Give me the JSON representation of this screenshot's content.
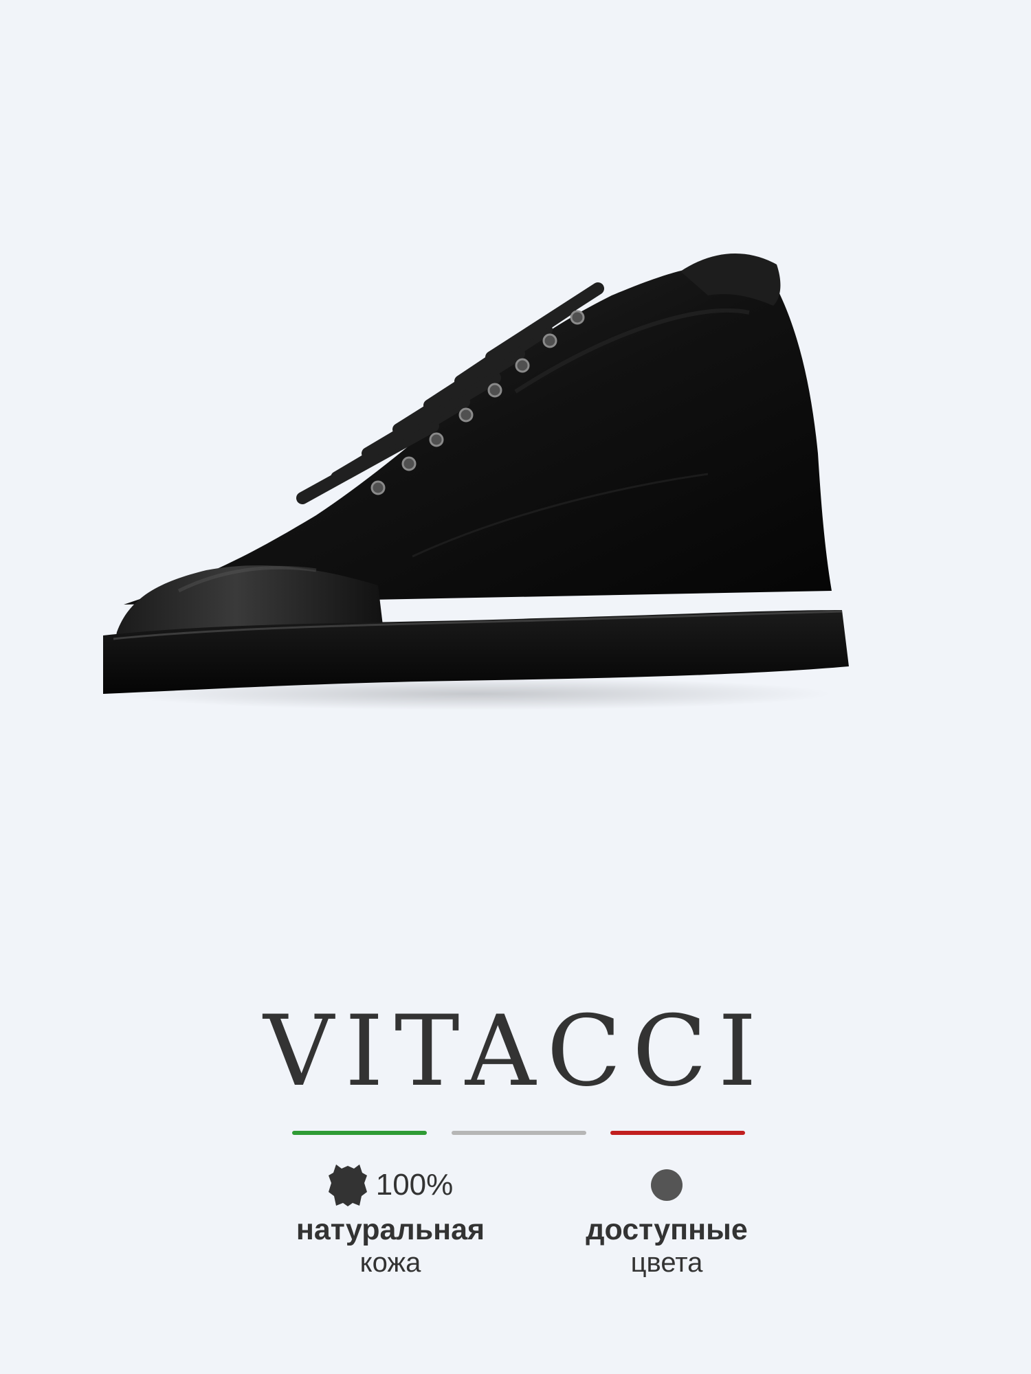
{
  "product": {
    "image_subject": "black leather high-top sneaker"
  },
  "brand": {
    "name": "VITACCI"
  },
  "flag_colors": {
    "green": "#2f9b35",
    "white": "#b6b6b6",
    "red": "#c11f1f"
  },
  "features": [
    {
      "icon": "leather-hide-icon",
      "value": "100%",
      "title": "натуральная",
      "subtitle": "кожа"
    },
    {
      "icon": "color-dot-icon",
      "value": "",
      "title": "доступные",
      "subtitle": "цвета",
      "swatch_color": "#555555"
    }
  ]
}
